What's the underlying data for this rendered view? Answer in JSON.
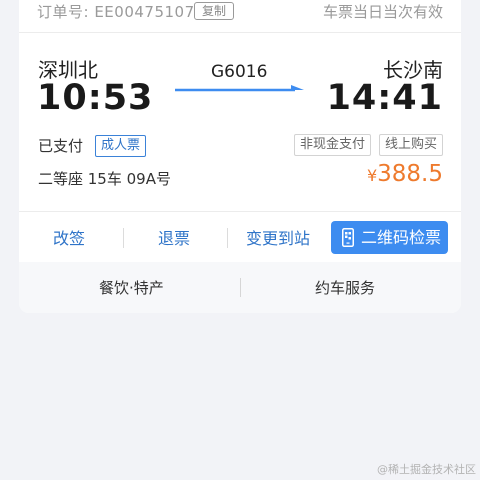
{
  "order": {
    "label": "订单号: EE00475107",
    "copy_label": "复制",
    "validity_note": "车票当日当次有效"
  },
  "trip": {
    "from_station": "深圳北",
    "from_time": "10:53",
    "train_no": "G6016",
    "to_station": "长沙南",
    "to_time": "14:41"
  },
  "ticket": {
    "status": "已支付",
    "type_badge": "成人票",
    "tags": [
      "非现金支付",
      "线上购买"
    ],
    "seat": "二等座 15车 09A号",
    "price_symbol": "¥",
    "price": "388.5"
  },
  "actions": {
    "reschedule": "改签",
    "refund": "退票",
    "change_station": "变更到站",
    "qr_check": "二维码检票"
  },
  "services": {
    "food": "餐饮·特产",
    "car": "约车服务"
  },
  "watermark": "@稀土掘金技术社区",
  "colors": {
    "accent": "#2f74c8",
    "qr_button": "#3d8cf0",
    "price": "#ee7a2d",
    "background": "#f2f3f7"
  },
  "icons": {
    "arrow": "right-arrow-icon",
    "qr": "phone-qr-icon"
  }
}
